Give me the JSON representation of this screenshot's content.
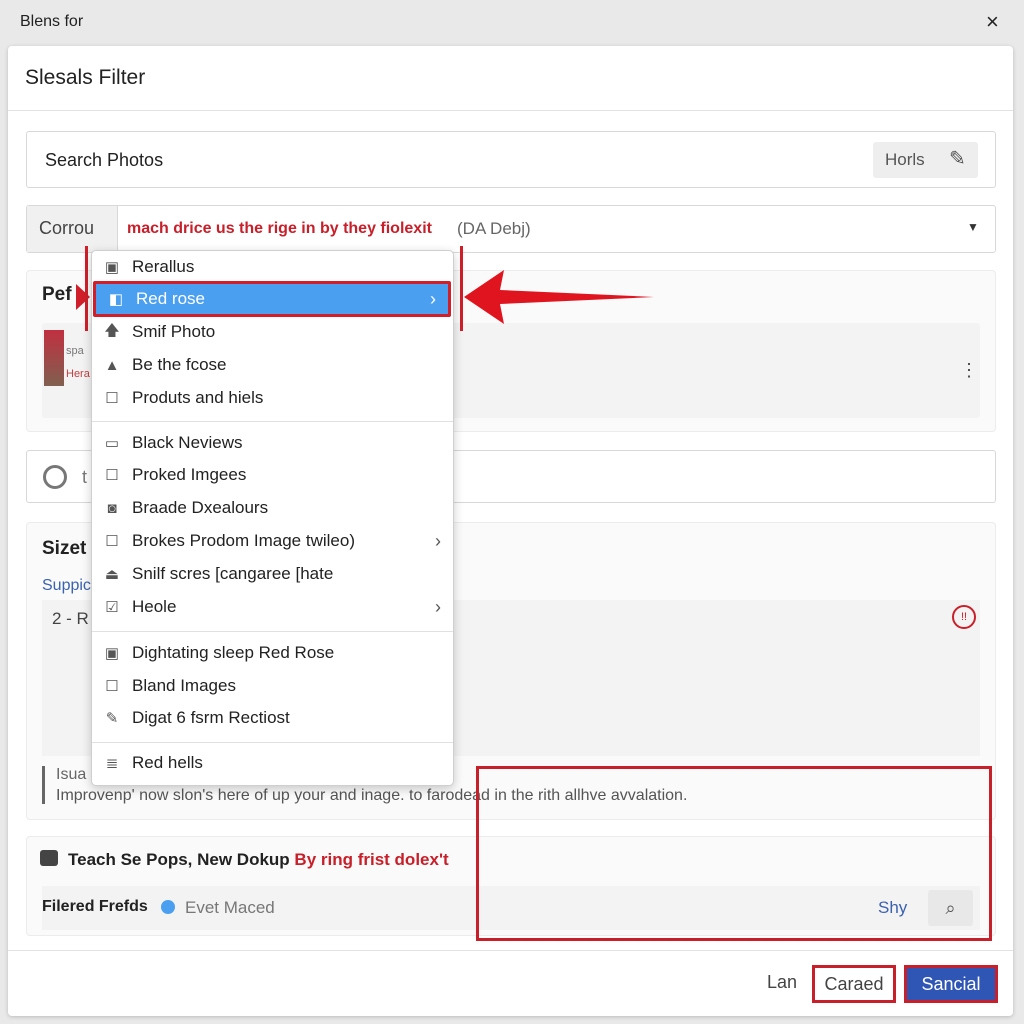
{
  "window": {
    "title": "Blens for",
    "close": "×"
  },
  "dialog": {
    "title": "Slesals Filter"
  },
  "search": {
    "placeholder": "Search Photos",
    "button": "Horls"
  },
  "filter": {
    "label": "Corrou",
    "value_red": "mach drice us the rige in by they fiolexit",
    "value_gray": "(DA Debj)"
  },
  "section1": {
    "heading": "Pef",
    "thumb_line1": "spa",
    "thumb_line2": "Hera"
  },
  "input2": {
    "text": "t"
  },
  "section2": {
    "heading": "Sizet",
    "link": "Suppic",
    "item": "2 - R",
    "note_label": "Isua",
    "note_text": "Improvenp' now slon's here of up your and inage. to farodead in the rith allhve avvalation."
  },
  "section3": {
    "heading_black": "Teach Se Pops, New Dokup",
    "heading_red": "By ring frist dolex't",
    "row_label": "Filered Frefds",
    "row_value": "Evet Maced",
    "row_link": "Shy"
  },
  "footer": {
    "link": "Lan",
    "cancel": "Caraed",
    "primary": "Sancial"
  },
  "menu": {
    "items": [
      {
        "label": "Rerallus",
        "icon": "image-icon"
      },
      {
        "label": "Red rose",
        "icon": "photo-icon",
        "submenu": true,
        "selected": true
      },
      {
        "label": "Smif Photo",
        "icon": "arrow-up-icon"
      },
      {
        "label": "Be the fcose",
        "icon": "lock-icon"
      },
      {
        "label": "Produts and hiels",
        "icon": "checkbox-icon"
      },
      {
        "label": "Black Neviews",
        "icon": "folder-icon"
      },
      {
        "label": "Proked Imgees",
        "icon": "checkbox-icon"
      },
      {
        "label": "Braade Dxealours",
        "icon": "record-icon"
      },
      {
        "label": "Brokes Prodom Image twileo)",
        "icon": "checkbox-icon",
        "submenu": true
      },
      {
        "label": "Snilf scres [cangaree [hate",
        "icon": "stamp-icon"
      },
      {
        "label": "Heole",
        "icon": "calendar-check-icon",
        "submenu": true
      },
      {
        "label": "Dightating sleep Red Rose",
        "icon": "smile-box-icon"
      },
      {
        "label": "Bland Images",
        "icon": "checkbox-icon"
      },
      {
        "label": "Digat 6 fsrm Rectiost",
        "icon": "pencil-icon"
      },
      {
        "label": "Red hells",
        "icon": "document-icon"
      }
    ]
  },
  "colors": {
    "accent": "#4a9ff0",
    "annotation": "#d01f2a",
    "primary_button": "#2f55b5"
  }
}
